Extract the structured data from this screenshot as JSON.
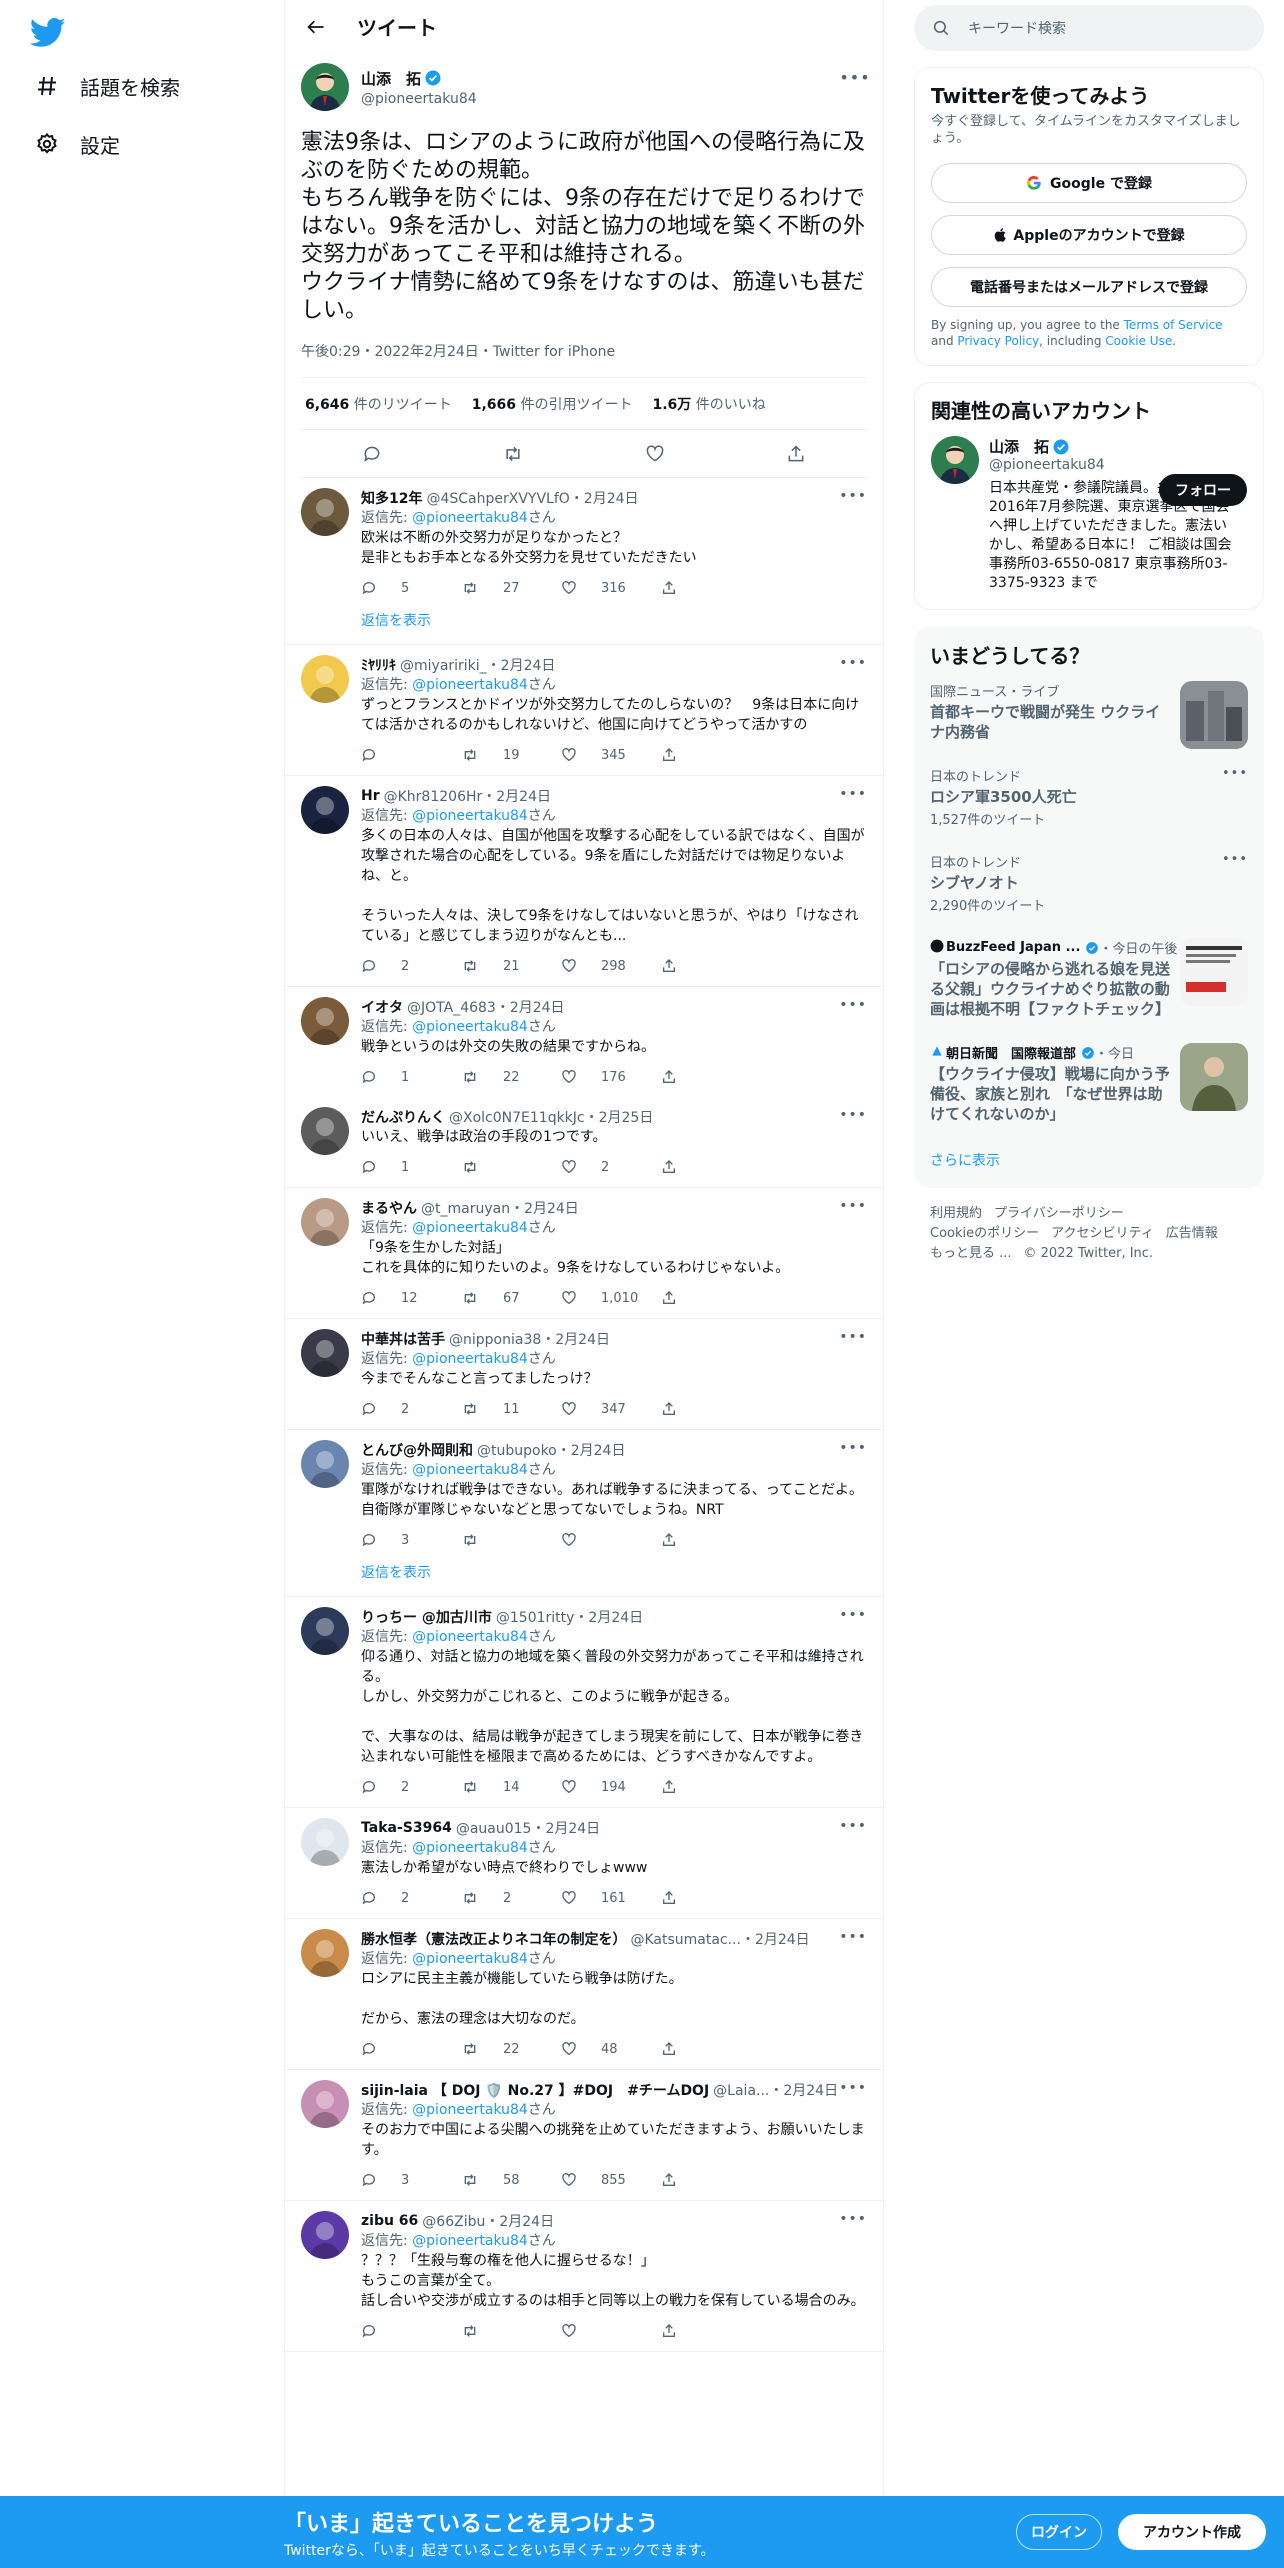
{
  "nav": {
    "explore_label": "話題を検索",
    "settings_label": "設定"
  },
  "header": {
    "title": "ツイート"
  },
  "focal": {
    "name": "山添　拓",
    "handle": "@pioneertaku84",
    "text": "憲法9条は、ロシアのように政府が他国への侵略行為に及ぶのを防ぐための規範。\nもちろん戦争を防ぐには、9条の存在だけで足りるわけではない。9条を活かし、対話と協力の地域を築く不断の外交努力があってこそ平和は維持される。\nウクライナ情勢に絡めて9条をけなすのは、筋違いも甚だしい。",
    "meta": "午後0:29・2022年2月24日・Twitter for iPhone",
    "retweets_count": "6,646",
    "retweets_label": "件のリツイート",
    "quotes_count": "1,666",
    "quotes_label": "件の引用ツイート",
    "likes_count": "1.6万",
    "likes_label": "件のいいね"
  },
  "reply_to_prefix": "返信先: ",
  "reply_to_handle": "@pioneertaku84",
  "reply_to_suffix": "さん",
  "show_replies_label": "返信を表示",
  "replies": [
    {
      "name": "知多12年",
      "handle": "@4SCahperXVYVLfO・2月24日",
      "text": "欧米は不断の外交努力が足りなかったと？\n是非ともお手本となる外交努力を見せていただきたい",
      "replies": "5",
      "retweets": "27",
      "likes": "316"
    },
    {
      "name": "ﾐﾔﾘﾘｷ",
      "handle": "@miyaririki_・2月24日",
      "text": "ずっとフランスとかドイツが外交努力してたのしらないの？　9条は日本に向けては活かされるのかもしれないけど、他国に向けてどうやって活かすの",
      "replies": "",
      "retweets": "19",
      "likes": "345"
    },
    {
      "name": "Hr",
      "handle": "@Khr81206Hr・2月24日",
      "text": "多くの日本の人々は、自国が他国を攻撃する心配をしている訳ではなく、自国が攻撃された場合の心配をしている。9条を盾にした対話だけでは物足りないよね、と。\n\nそういった人々は、決して9条をけなしてはいないと思うが、やはり「けなされている」と感じてしまう辺りがなんとも...",
      "replies": "2",
      "retweets": "21",
      "likes": "298"
    },
    {
      "name": "イオタ",
      "handle": "@JOTA_4683・2月24日",
      "text": "戦争というのは外交の失敗の結果ですからね。",
      "replies": "1",
      "retweets": "22",
      "likes": "176"
    },
    {
      "name": "だんぷりんく",
      "handle": "@Xolc0N7E11qkkJc・2月25日",
      "text": "いいえ、戦争は政治の手段の1つです。",
      "replies": "1",
      "retweets": "",
      "likes": "2"
    },
    {
      "name": "まるやん",
      "handle": "@t_maruyan・2月24日",
      "text": "「9条を生かした対話」\nこれを具体的に知りたいのよ。9条をけなしているわけじゃないよ。",
      "replies": "12",
      "retweets": "67",
      "likes": "1,010"
    },
    {
      "name": "中華丼は苦手",
      "handle": "@nipponia38・2月24日",
      "text": "今までそんなこと言ってましたっけ？",
      "replies": "2",
      "retweets": "11",
      "likes": "347"
    },
    {
      "name": "とんび@外岡則和",
      "handle": "@tubupoko・2月24日",
      "text": "軍隊がなければ戦争はできない。あれば戦争するに決まってる、ってことだよ。自衛隊が軍隊じゃないなどと思ってないでしょうね。NRT",
      "replies": "3",
      "retweets": "",
      "likes": ""
    },
    {
      "name": "りっちー @加古川市",
      "handle": "@1501ritty・2月24日",
      "text": "仰る通り、対話と協力の地域を築く普段の外交努力があってこそ平和は維持される。\nしかし、外交努力がこじれると、このように戦争が起きる。\n\nで、大事なのは、結局は戦争が起きてしまう現実を前にして、日本が戦争に巻き込まれない可能性を極限まで高めるためには、どうすべきかなんですよ。",
      "replies": "2",
      "retweets": "14",
      "likes": "194"
    },
    {
      "name": "Taka-S3964",
      "handle": "@auau015・2月24日",
      "text": "憲法しか希望がない時点で終わりでしょwww",
      "replies": "2",
      "retweets": "2",
      "likes": "161"
    },
    {
      "name": "勝水恒孝（憲法改正よりネコ年の制定を）",
      "handle": "@Katsumatac...・2月24日",
      "text": "ロシアに民主主義が機能していたら戦争は防げた。\n\nだから、憲法の理念は大切なのだ。",
      "replies": "",
      "retweets": "22",
      "likes": "48"
    },
    {
      "name": "sijin-laia 【 DOJ 🛡️ No.27 】#DOJ　#チームDOJ",
      "handle": "@Laia...・2月24日",
      "text": "そのお力で中国による尖閣への挑発を止めていただきますよう、お願いいたします。",
      "replies": "3",
      "retweets": "58",
      "likes": "855"
    },
    {
      "name": "zibu 66",
      "handle": "@66Zibu・2月24日",
      "text": "？？？「生殺与奪の権を他人に握らせるな！」\nもうこの言葉が全て。\n話し合いや交渉が成立するのは相手と同等以上の戦力を保有している場合のみ。",
      "replies": "",
      "retweets": "",
      "likes": ""
    }
  ],
  "right": {
    "search_placeholder": "キーワード検索",
    "signup_title": "Twitterを使ってみよう",
    "signup_sub": "今すぐ登録して、タイムラインをカスタマイズしましょう。",
    "google_btn": "Google で登録",
    "apple_btn": "Appleのアカウントで登録",
    "phone_btn": "電話番号またはメールアドレスで登録",
    "legal_1": "By signing up, you agree to the ",
    "legal_tos": "Terms of Service",
    "legal_2": " and ",
    "legal_privacy": "Privacy Policy",
    "legal_3": ", including ",
    "legal_cookie": "Cookie Use",
    "legal_4": ".",
    "related_title": "関連性の高いアカウント",
    "related_name": "山添　拓",
    "related_handle": "@pioneertaku84",
    "related_follow": "フォロー",
    "related_bio": "日本共産党・参議院議員。弁護士。2016年7月参院選、東京選挙区で国会へ押し上げていただきました。憲法いかし、希望ある日本に！ ご相談は国会事務所03-6550-0817 東京事務所03-3375-9323 まで",
    "trends_title": "いまどうしてる？",
    "trends": [
      {
        "context": "国際ニュース・ライブ",
        "title": "首都キーウで戦闘が発生 ウクライナ内務省",
        "count": ""
      },
      {
        "context": "日本のトレンド",
        "title": "ロシア軍3500人死亡",
        "count": "1,527件のツイート"
      },
      {
        "context": "日本のトレンド",
        "title": "シブヤノオト",
        "count": "2,290件のツイート"
      }
    ],
    "news": [
      {
        "source": "BuzzFeed Japan ...",
        "time": "・今日の午後",
        "title": "「ロシアの侵略から逃れる娘を見送る父親」ウクライナめぐり拡散の動画は根拠不明【ファクトチェック】"
      },
      {
        "source": "朝日新聞　国際報道部",
        "time": "・今日",
        "title": "【ウクライナ侵攻】戦場に向かう予備役、家族と別れ　「なぜ世界は助けてくれないのか」"
      }
    ],
    "show_more": "さらに表示",
    "footer_links": [
      "利用規約",
      "プライバシーポリシー",
      "Cookieのポリシー",
      "アクセシビリティ",
      "広告情報",
      "もっと見る ...",
      "© 2022 Twitter, Inc."
    ]
  },
  "bottom": {
    "title": "「いま」起きていることを見つけよう",
    "sub": "Twitterなら、「いま」起きていることをいち早くチェックできます。",
    "login": "ログイン",
    "signup": "アカウント作成"
  },
  "colors": {
    "accent": "#1d9bf0",
    "text": "#0f1419",
    "secondary": "#536471"
  }
}
